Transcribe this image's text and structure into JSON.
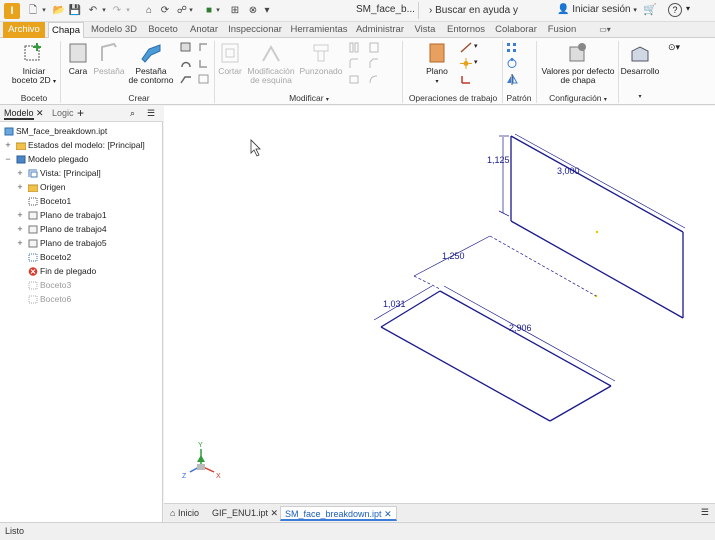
{
  "titlebar": {
    "logo_letter": "I",
    "document_title": "SM_face_b...",
    "search_placeholder": "Buscar en ayuda y comandos...",
    "signin_label": "Iniciar sesión",
    "help_label": "?"
  },
  "tabs": [
    {
      "label": "Archivo"
    },
    {
      "label": "Chapa"
    },
    {
      "label": "Modelo 3D"
    },
    {
      "label": "Boceto"
    },
    {
      "label": "Anotar"
    },
    {
      "label": "Inspeccionar"
    },
    {
      "label": "Herramientas"
    },
    {
      "label": "Administrar"
    },
    {
      "label": "Vista"
    },
    {
      "label": "Entornos"
    },
    {
      "label": "Colaborar"
    },
    {
      "label": "Fusion"
    }
  ],
  "ribbon": {
    "boceto": {
      "start_sketch": "Iniciar",
      "start_sketch_2": "boceto 2D",
      "panel": "Boceto"
    },
    "crear": {
      "cara": "Cara",
      "pestana": "Pestaña",
      "pestana_contorno_1": "Pestaña",
      "pestana_contorno_2": "de contorno",
      "panel": "Crear"
    },
    "modificar": {
      "cortar": "Cortar",
      "modificacion_1": "Modificación",
      "modificacion_2": "de esquina",
      "punzonado": "Punzonado",
      "panel": "Modificar"
    },
    "operaciones": {
      "plano": "Plano",
      "panel": "Operaciones de trabajo"
    },
    "patron": {
      "panel": "Patrón"
    },
    "configuracion": {
      "valores_1": "Valores por defecto",
      "valores_2": "de chapa",
      "panel": "Configuración"
    },
    "desarrollo": {
      "label": "Desarrollo"
    }
  },
  "browser": {
    "tab_model": "Modelo",
    "tab_close": "✕",
    "tab_logic": "Logic",
    "tab_add": "+",
    "items": [
      {
        "label": "SM_face_breakdown.ipt"
      },
      {
        "label": "Estados del modelo: [Principal]"
      },
      {
        "label": "Modelo plegado"
      },
      {
        "label": "Vista: [Principal]"
      },
      {
        "label": "Origen"
      },
      {
        "label": "Boceto1"
      },
      {
        "label": "Plano de trabajo1"
      },
      {
        "label": "Plano de trabajo4"
      },
      {
        "label": "Plano de trabajo5"
      },
      {
        "label": "Boceto2"
      },
      {
        "label": "Fin de plegado"
      },
      {
        "label": "Boceto3"
      },
      {
        "label": "Boceto6"
      }
    ]
  },
  "viewport": {
    "dimensions": [
      "1,125",
      "3,000",
      "1,250",
      "1,031",
      "2,906"
    ],
    "axis_labels": {
      "y": "Y",
      "x": "X",
      "z": "Z"
    }
  },
  "document_tabs": [
    {
      "label": "Inicio"
    },
    {
      "label": "GIF_ENU1.ipt"
    },
    {
      "label": "SM_face_breakdown.ipt"
    }
  ],
  "status": {
    "text": "Listo"
  },
  "colors": {
    "accent_orange": "#e8a21c",
    "sketch_blue": "#1a1a8c",
    "active_tab_blue": "#3b7dd8"
  }
}
